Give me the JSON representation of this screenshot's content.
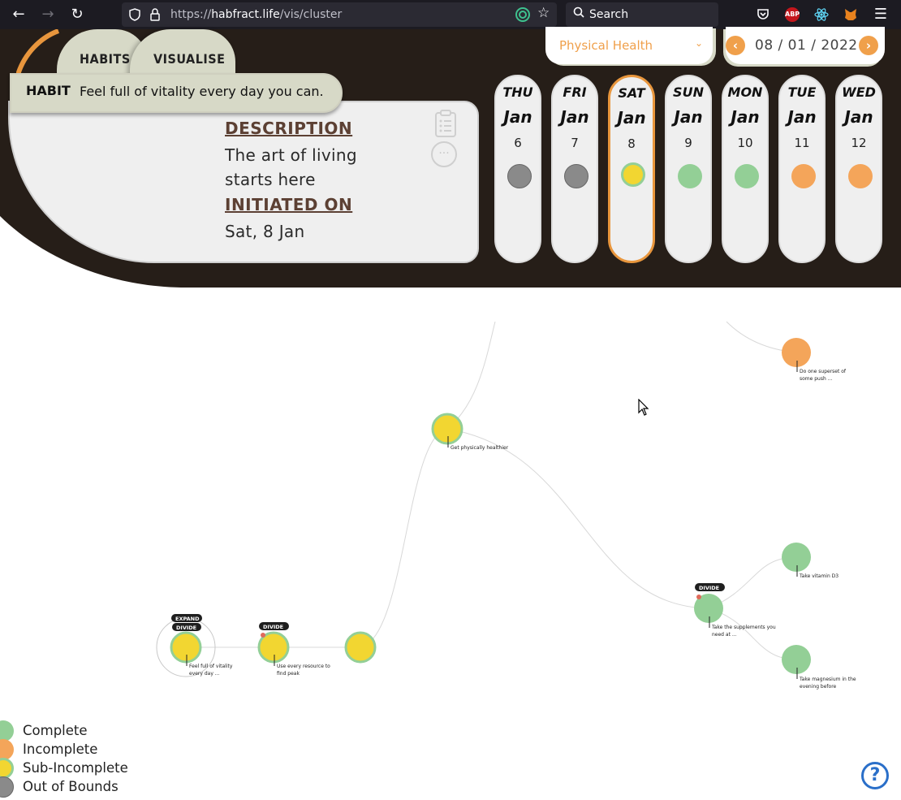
{
  "browser": {
    "url_prefix": "https://",
    "url_domain": "habfract.life",
    "url_path": "/vis/cluster",
    "search_placeholder": "Search",
    "ext_abp": "ABP"
  },
  "tabs": {
    "habits": "HABITS",
    "visualise": "VISUALISE"
  },
  "habit": {
    "label": "HABIT",
    "value": "Feel full of vitality every day you can."
  },
  "details": {
    "description_label": "DESCRIPTION",
    "description_text": "The art of living starts here",
    "initiated_label": "INITIATED ON",
    "initiated_text": "Sat, 8 Jan"
  },
  "category_select": {
    "value": "Physical Health"
  },
  "date_nav": {
    "date": "08 / 01 / 2022"
  },
  "days": [
    {
      "name": "THU",
      "month": "Jan",
      "num": "6",
      "status": "out-of-bounds"
    },
    {
      "name": "FRI",
      "month": "Jan",
      "num": "7",
      "status": "out-of-bounds"
    },
    {
      "name": "SAT",
      "month": "Jan",
      "num": "8",
      "status": "sub-incomplete",
      "selected": true
    },
    {
      "name": "SUN",
      "month": "Jan",
      "num": "9",
      "status": "complete"
    },
    {
      "name": "MON",
      "month": "Jan",
      "num": "10",
      "status": "complete"
    },
    {
      "name": "TUE",
      "month": "Jan",
      "num": "11",
      "status": "incomplete"
    },
    {
      "name": "WED",
      "month": "Jan",
      "num": "12",
      "status": "incomplete"
    }
  ],
  "tree": {
    "tags": {
      "expand": "EXPAND",
      "divide": "DIVIDE"
    },
    "nodes": {
      "root_l1": "Feel full of vitality",
      "root_l2": "every day ...",
      "resource_l1": "Use every resource to",
      "resource_l2": "find peak",
      "healthier": "Get physically healthier",
      "superset_l1": "Do one superset of",
      "superset_l2": "some push ...",
      "supplements_l1": "Take the supplements you",
      "supplements_l2": "need at ...",
      "vitamin": "Take vitamin D3",
      "magnesium_l1": "Take magnesium in the",
      "magnesium_l2": "evening before"
    }
  },
  "legend": [
    {
      "label": "Complete",
      "status": "complete"
    },
    {
      "label": "Incomplete",
      "status": "incomplete"
    },
    {
      "label": "Sub-Incomplete",
      "status": "sub-incomplete"
    },
    {
      "label": "Out of Bounds",
      "status": "out-of-bounds"
    }
  ],
  "colors": {
    "complete": "#93cf96",
    "incomplete": "#f4a55a",
    "sub_incomplete_fill": "#f2d631",
    "sub_incomplete_ring": "#93cf96",
    "out_of_bounds": "#8a8a8a",
    "header_dark": "#261e18",
    "accent_orange": "#e8963d"
  },
  "help": {
    "symbol": "?"
  }
}
